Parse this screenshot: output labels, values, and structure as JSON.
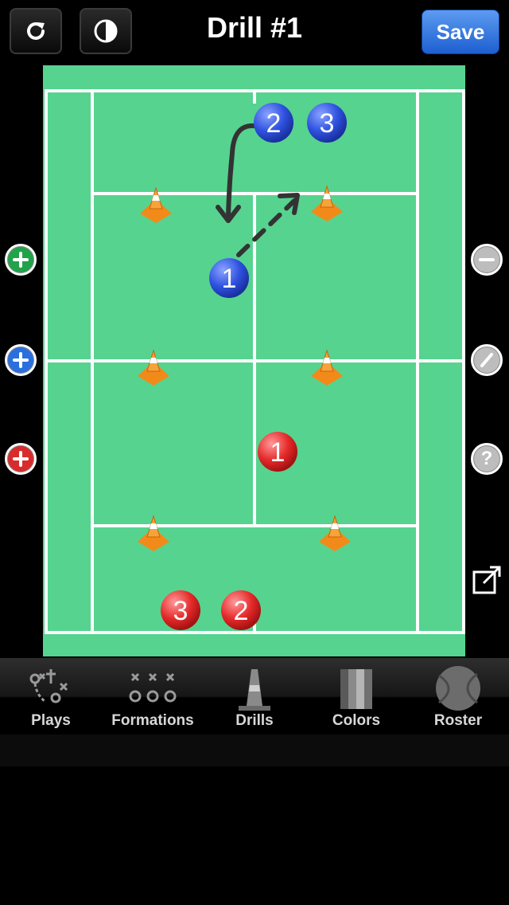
{
  "header": {
    "title": "Drill #1",
    "save_label": "Save",
    "refresh_icon": "refresh-icon",
    "contrast_icon": "contrast-icon"
  },
  "left_buttons": [
    {
      "name": "add-green-button",
      "color": "#21a34a",
      "icon": "plus-icon"
    },
    {
      "name": "add-blue-button",
      "color": "#2a6fe0",
      "icon": "plus-icon"
    },
    {
      "name": "add-red-button",
      "color": "#d92b2b",
      "icon": "plus-icon"
    }
  ],
  "right_buttons": [
    {
      "name": "remove-button",
      "icon": "minus-icon"
    },
    {
      "name": "draw-line-button",
      "icon": "slash-icon"
    },
    {
      "name": "help-button",
      "icon": "question-icon",
      "glyph": "?"
    },
    {
      "name": "share-button",
      "icon": "share-icon"
    }
  ],
  "players": {
    "blue": [
      {
        "label": "2"
      },
      {
        "label": "3"
      },
      {
        "label": "1"
      }
    ],
    "red": [
      {
        "label": "1"
      },
      {
        "label": "3"
      },
      {
        "label": "2"
      }
    ]
  },
  "colors": {
    "court": "#56d38f",
    "blue_player": "#2f52e0",
    "red_player": "#e52a2a",
    "cone": "#f28a1a",
    "accent": "#1d5fd1"
  },
  "tabs": [
    {
      "label": "Plays",
      "icon": "plays-icon"
    },
    {
      "label": "Formations",
      "icon": "formations-icon"
    },
    {
      "label": "Drills",
      "icon": "cone-icon"
    },
    {
      "label": "Colors",
      "icon": "colors-icon"
    },
    {
      "label": "Roster",
      "icon": "ball-icon"
    }
  ]
}
